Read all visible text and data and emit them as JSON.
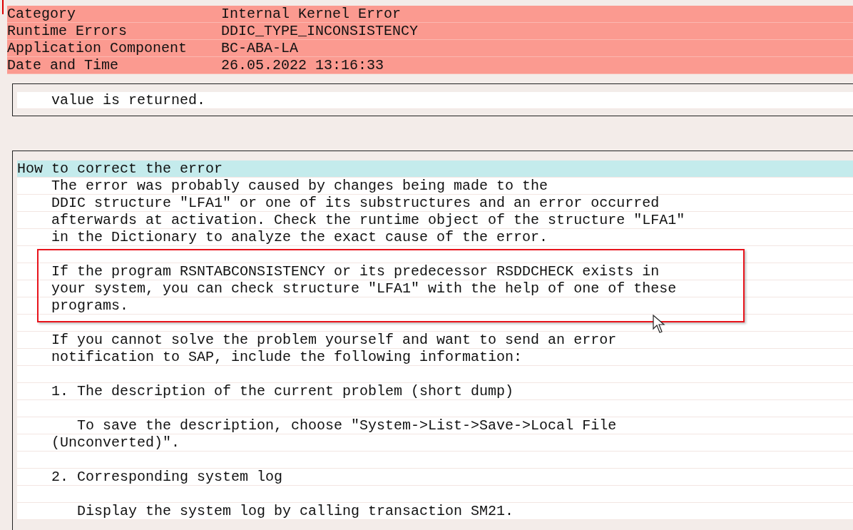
{
  "header": [
    {
      "label": "Category",
      "value": "Internal Kernel Error"
    },
    {
      "label": "Runtime Errors",
      "value": "DDIC_TYPE_INCONSISTENCY"
    },
    {
      "label": "Application Component",
      "value": "BC-ABA-LA"
    },
    {
      "label": "Date and Time",
      "value": "26.05.2022 13:16:33"
    }
  ],
  "sections": [
    {
      "lines": [
        {
          "kind": "text",
          "text": "    value is returned."
        }
      ]
    },
    {
      "title": "How to correct the error",
      "lines": [
        {
          "kind": "text",
          "text": "    The error was probably caused by changes being made to the"
        },
        {
          "kind": "text",
          "text": "    DDIC structure \"LFA1\" or one of its substructures and an error occurred"
        },
        {
          "kind": "text",
          "text": "    afterwards at activation. Check the runtime object of the structure \"LFA1\""
        },
        {
          "kind": "text",
          "text": "    in the Dictionary to analyze the exact cause of the error."
        },
        {
          "kind": "blank"
        },
        {
          "kind": "text",
          "text": "    If the program RSNTABCONSISTENCY or its predecessor RSDDCHECK exists in"
        },
        {
          "kind": "text",
          "text": "    your system, you can check structure \"LFA1\" with the help of one of these"
        },
        {
          "kind": "text",
          "text": "    programs."
        },
        {
          "kind": "blank"
        },
        {
          "kind": "text",
          "text": "    If you cannot solve the problem yourself and want to send an error"
        },
        {
          "kind": "text",
          "text": "    notification to SAP, include the following information:"
        },
        {
          "kind": "blank"
        },
        {
          "kind": "text",
          "text": "    1. The description of the current problem (short dump)"
        },
        {
          "kind": "blank"
        },
        {
          "kind": "text",
          "text": "       To save the description, choose \"System->List->Save->Local File"
        },
        {
          "kind": "text",
          "text": "    (Unconverted)\"."
        },
        {
          "kind": "blank"
        },
        {
          "kind": "text",
          "text": "    2. Corresponding system log"
        },
        {
          "kind": "blank"
        },
        {
          "kind": "text",
          "text": "       Display the system log by calling transaction SM21."
        }
      ]
    }
  ]
}
